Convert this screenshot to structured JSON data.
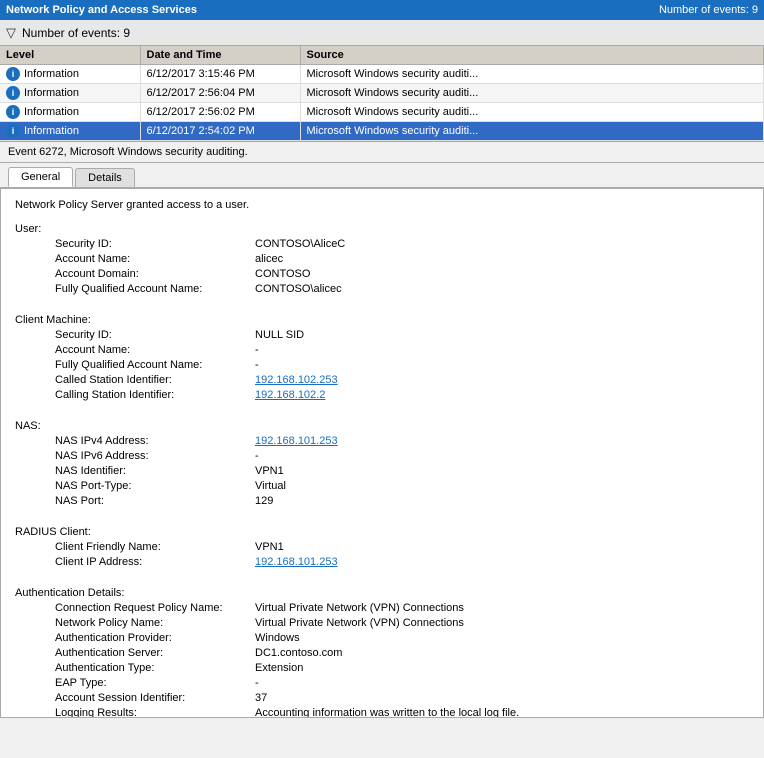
{
  "titleBar": {
    "title": "Network Policy and Access Services",
    "eventCount": "Number of events: 9"
  },
  "filterBar": {
    "text": "Number of events: 9"
  },
  "tableHeaders": {
    "level": "Level",
    "dateTime": "Date and Time",
    "source": "Source"
  },
  "events": [
    {
      "level": "Information",
      "dateTime": "6/12/2017 3:15:46 PM",
      "source": "Microsoft Windows security auditi...",
      "selected": false
    },
    {
      "level": "Information",
      "dateTime": "6/12/2017 2:56:04 PM",
      "source": "Microsoft Windows security auditi...",
      "selected": false
    },
    {
      "level": "Information",
      "dateTime": "6/12/2017 2:56:02 PM",
      "source": "Microsoft Windows security auditi...",
      "selected": false
    },
    {
      "level": "Information",
      "dateTime": "6/12/2017 2:54:02 PM",
      "source": "Microsoft Windows security auditi...",
      "selected": true
    }
  ],
  "eventDescription": "Event 6272, Microsoft Windows security auditing.",
  "tabs": [
    {
      "label": "General",
      "active": true
    },
    {
      "label": "Details",
      "active": false
    }
  ],
  "detail": {
    "intro": "Network Policy Server granted access to a user.",
    "sections": [
      {
        "label": "User:",
        "fields": [
          {
            "key": "Security ID:",
            "value": "CONTOSO\\AliceC",
            "link": false
          },
          {
            "key": "Account Name:",
            "value": "alicec",
            "link": false
          },
          {
            "key": "Account Domain:",
            "value": "CONTOSO",
            "link": false
          },
          {
            "key": "Fully Qualified Account Name:",
            "value": "CONTOSO\\alicec",
            "link": false
          }
        ]
      },
      {
        "label": "Client Machine:",
        "fields": [
          {
            "key": "Security ID:",
            "value": "NULL SID",
            "link": false
          },
          {
            "key": "Account Name:",
            "value": "-",
            "link": false
          },
          {
            "key": "Fully Qualified Account Name:",
            "value": "-",
            "link": false
          },
          {
            "key": "Called Station Identifier:",
            "value": "192.168.102.253",
            "link": true
          },
          {
            "key": "Calling Station Identifier:",
            "value": "192.168.102.2",
            "link": true
          }
        ]
      },
      {
        "label": "NAS:",
        "fields": [
          {
            "key": "NAS IPv4 Address:",
            "value": "192.168.101.253",
            "link": true
          },
          {
            "key": "NAS IPv6 Address:",
            "value": "-",
            "link": false
          },
          {
            "key": "NAS Identifier:",
            "value": "VPN1",
            "link": false
          },
          {
            "key": "NAS Port-Type:",
            "value": "Virtual",
            "link": false
          },
          {
            "key": "NAS Port:",
            "value": "129",
            "link": false
          }
        ]
      },
      {
        "label": "RADIUS Client:",
        "fields": [
          {
            "key": "Client Friendly Name:",
            "value": "VPN1",
            "link": false
          },
          {
            "key": "Client IP Address:",
            "value": "192.168.101.253",
            "link": true
          }
        ]
      },
      {
        "label": "Authentication Details:",
        "fields": [
          {
            "key": "Connection Request Policy Name:",
            "value": "Virtual Private Network (VPN) Connections",
            "link": false
          },
          {
            "key": "Network Policy Name:",
            "value": "Virtual Private Network (VPN) Connections",
            "link": false
          },
          {
            "key": "Authentication Provider:",
            "value": "Windows",
            "link": false
          },
          {
            "key": "Authentication Server:",
            "value": "DC1.contoso.com",
            "link": false
          },
          {
            "key": "Authentication Type:",
            "value": "Extension",
            "link": false
          },
          {
            "key": "EAP Type:",
            "value": "-",
            "link": false
          },
          {
            "key": "Account Session Identifier:",
            "value": "37",
            "link": false
          },
          {
            "key": "Logging Results:",
            "value": "Accounting information was written to the local log file.",
            "link": false
          }
        ]
      }
    ]
  }
}
